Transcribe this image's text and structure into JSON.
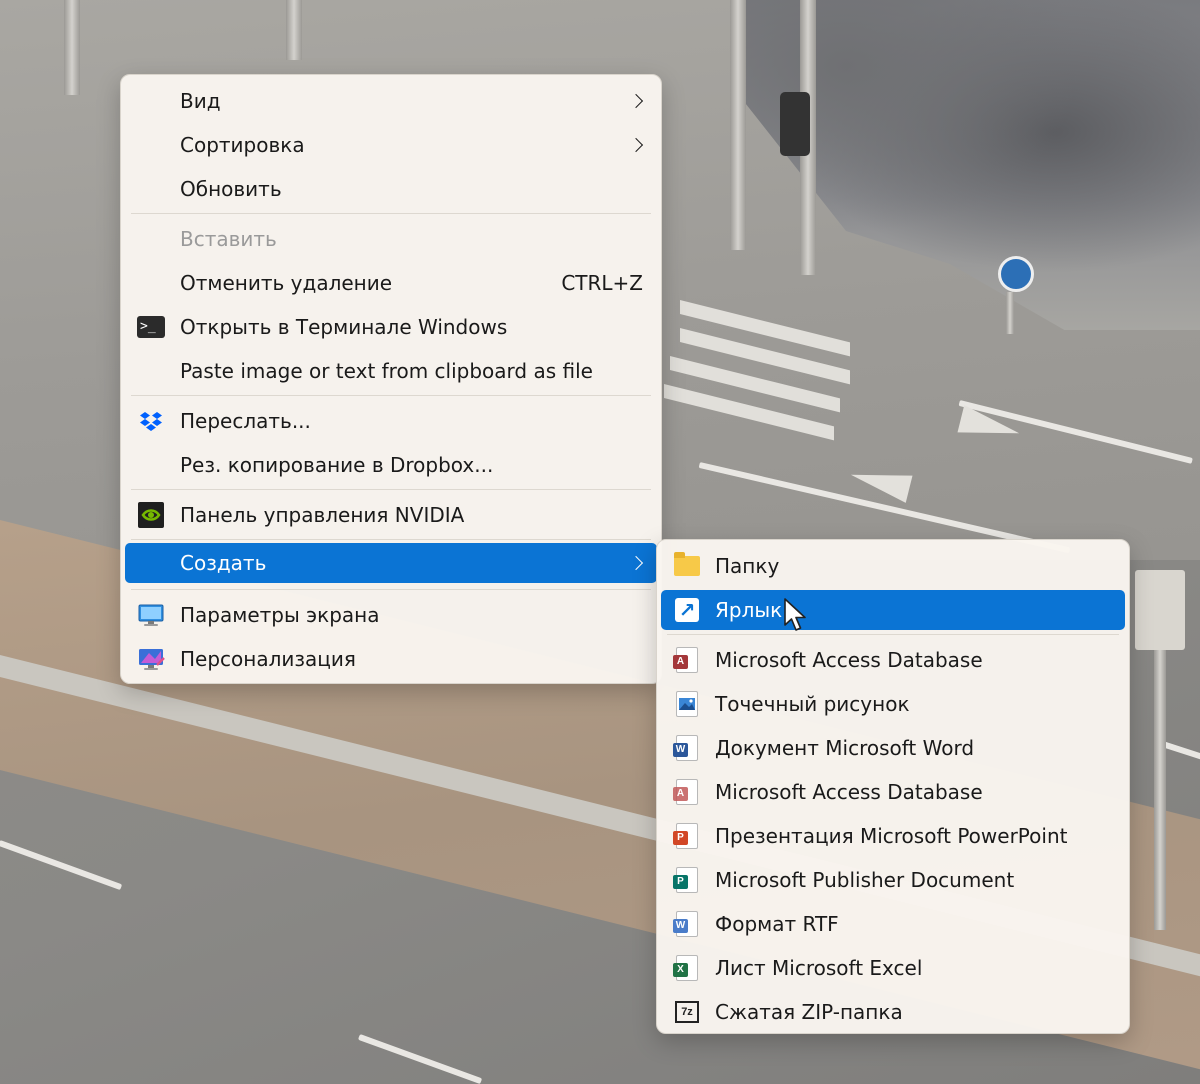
{
  "colors": {
    "selected": "#0b74d4",
    "menu_bg": "#f9f5f0",
    "text": "#1a1a1a",
    "disabled": "#9a9a9a"
  },
  "context_menu": {
    "items": [
      {
        "label": "Вид",
        "submenu": true
      },
      {
        "label": "Сортировка",
        "submenu": true
      },
      {
        "label": "Обновить"
      },
      {
        "label": "Вставить",
        "disabled": true
      },
      {
        "label": "Отменить удаление",
        "shortcut": "CTRL+Z"
      },
      {
        "label": "Открыть в Терминале Windows",
        "icon": "terminal-icon"
      },
      {
        "label": "Paste image or text from clipboard as file"
      },
      {
        "label": "Переслать...",
        "icon": "dropbox-icon"
      },
      {
        "label": "Рез. копирование в Dropbox..."
      },
      {
        "label": "Панель управления NVIDIA",
        "icon": "nvidia-icon"
      },
      {
        "label": "Создать",
        "submenu": true,
        "selected": true
      },
      {
        "label": "Параметры экрана",
        "icon": "display-icon"
      },
      {
        "label": "Персонализация",
        "icon": "personalization-icon"
      }
    ]
  },
  "new_submenu": {
    "items": [
      {
        "label": "Папку",
        "icon": "folder-icon"
      },
      {
        "label": "Ярлык",
        "icon": "shortcut-icon",
        "selected": true
      },
      {
        "label": "Microsoft Access Database",
        "icon": "access-icon"
      },
      {
        "label": "Точечный рисунок",
        "icon": "bitmap-icon"
      },
      {
        "label": "Документ Microsoft Word",
        "icon": "word-icon"
      },
      {
        "label": "Microsoft Access Database",
        "icon": "access-icon"
      },
      {
        "label": "Презентация Microsoft PowerPoint",
        "icon": "powerpoint-icon"
      },
      {
        "label": "Microsoft Publisher Document",
        "icon": "publisher-icon"
      },
      {
        "label": "Формат RTF",
        "icon": "rtf-icon"
      },
      {
        "label": "Лист Microsoft Excel",
        "icon": "excel-icon"
      },
      {
        "label": "Сжатая ZIP-папка",
        "icon": "zip-icon"
      }
    ]
  },
  "icons": {
    "terminal_glyph": ">_",
    "shortcut_glyph": "↗",
    "access_letter": "A",
    "word_letter": "W",
    "powerpoint_letter": "P",
    "publisher_letter": "P",
    "excel_letter": "X",
    "zip_text": "7z"
  }
}
